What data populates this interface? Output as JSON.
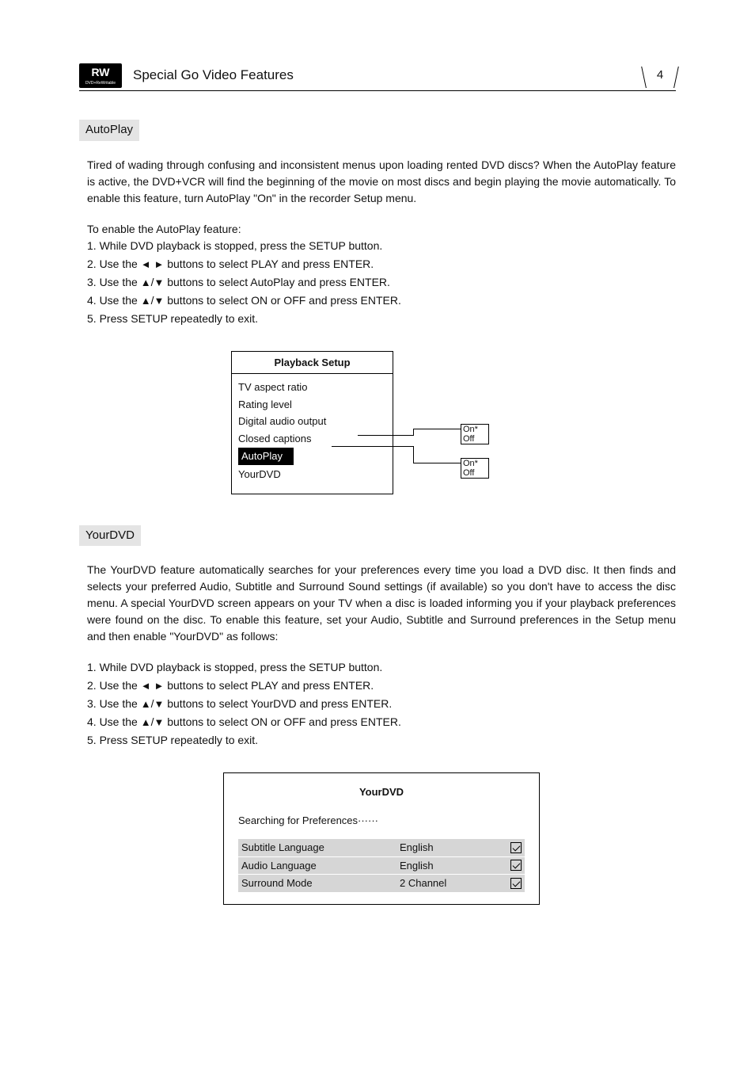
{
  "header": {
    "badge_top": "RW",
    "badge_bottom": "DVD+ReWritable",
    "title": "Special Go Video Features",
    "page_number": "4"
  },
  "autoplay": {
    "tag": "AutoPlay",
    "intro": "Tired of wading through confusing and inconsistent menus upon loading rented DVD discs? When the AutoPlay feature is active, the DVD+VCR will find the beginning of the movie on most discs and begin playing the movie automatically. To enable this feature, turn AutoPlay \"On\" in the recorder Setup menu.",
    "enable_line": "To enable the AutoPlay feature:",
    "steps": {
      "s1": "1. While DVD playback is stopped, press the SETUP button.",
      "s2a": "2. Use the ",
      "s2b": " buttons to select PLAY and press ENTER.",
      "s3a": "3. Use the ",
      "s3b": " buttons to select AutoPlay and press ENTER.",
      "s4a": "4. Use the ",
      "s4b": " buttons to select ON or OFF and press ENTER.",
      "s5": "5. Press SETUP repeatedly to exit."
    }
  },
  "playback_setup": {
    "title": "Playback Setup",
    "items": {
      "i1": "TV aspect ratio",
      "i2": "Rating level",
      "i3": "Digital audio output",
      "i4": "Closed captions",
      "i5": "AutoPlay",
      "i6": "YourDVD"
    },
    "option_on": "On*",
    "option_off": "Off"
  },
  "yourdvd": {
    "tag": "YourDVD",
    "intro": "The YourDVD feature automatically searches for your preferences every time you load a DVD disc. It then finds and selects your preferred Audio, Subtitle and Surround Sound settings (if available) so you don't have to access the disc menu. A special YourDVD screen appears on your TV when a disc is loaded informing you if your playback preferences were found on the disc. To enable this feature, set your Audio, Subtitle and Surround preferences in the Setup menu and then enable \"YourDVD\" as follows:",
    "steps": {
      "s1": "1. While DVD playback is stopped, press the SETUP button.",
      "s2a": "2. Use the ",
      "s2b": " buttons to select PLAY and press ENTER.",
      "s3a": "3. Use the ",
      "s3b": " buttons to select YourDVD and press ENTER.",
      "s4a": "4. Use the ",
      "s4b": " buttons to select ON or OFF and press ENTER.",
      "s5": "5. Press SETUP repeatedly to exit."
    },
    "box": {
      "title": "YourDVD",
      "status": "Searching for Preferences······",
      "rows": {
        "r1_label": "Subtitle Language",
        "r1_value": "English",
        "r2_label": "Audio  Language",
        "r2_value": "English",
        "r3_label": "Surround Mode",
        "r3_value": "2  Channel"
      }
    }
  },
  "glyphs": {
    "left": "◄",
    "right": "►",
    "up": "▲",
    "down": "▼",
    "sep": "/"
  }
}
